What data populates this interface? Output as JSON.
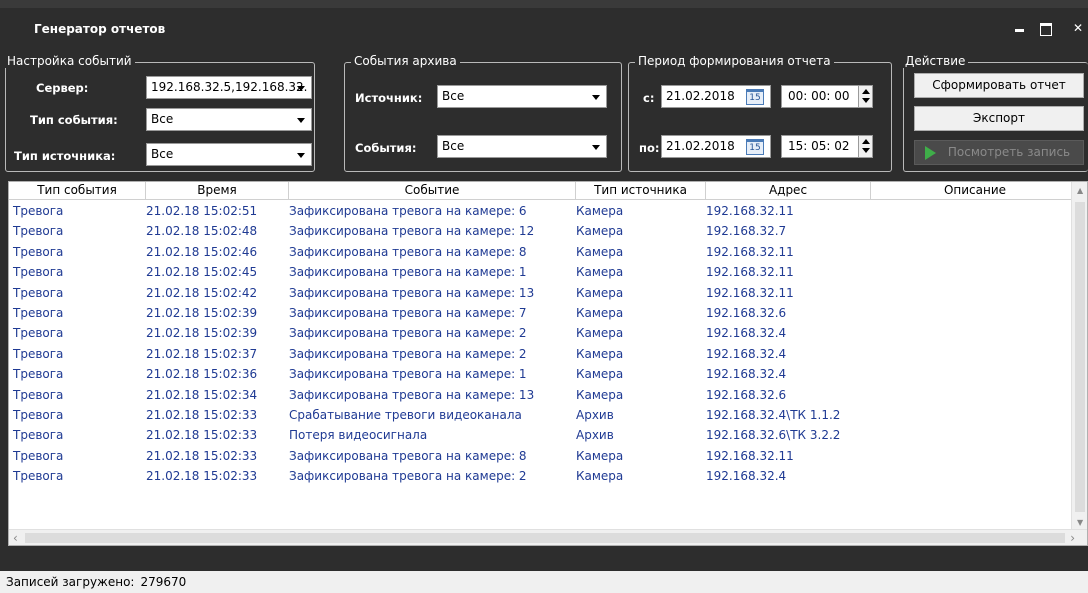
{
  "window": {
    "title": "Генератор отчетов"
  },
  "events_setup": {
    "title": "Настройка событий",
    "server_label": "Сервер:",
    "server_value": "192.168.32.5,192.168.32.",
    "event_type_label": "Тип события:",
    "event_type_value": "Все",
    "source_type_label": "Тип источника:",
    "source_type_value": "Все"
  },
  "archive_events": {
    "title": "События архива",
    "source_label": "Источник:",
    "source_value": "Все",
    "events_label": "События:",
    "events_value": "Все"
  },
  "period": {
    "title": "Период формирования отчета",
    "from_label": "с:",
    "from_date": "21.02.2018",
    "from_time": "00: 00: 00",
    "to_label": "по:",
    "to_date": "21.02.2018",
    "to_time": "15: 05: 02",
    "calendar_day": "15"
  },
  "actions": {
    "title": "Действие",
    "generate_label": "Сформировать отчет",
    "export_label": "Экспорт",
    "view_record_label": "Посмотреть запись"
  },
  "table": {
    "columns": [
      "Тип события",
      "Время",
      "Событие",
      "Тип источника",
      "Адрес",
      "Описание"
    ],
    "rows": [
      [
        "Тревога",
        "21.02.18 15:02:51",
        "Зафиксирована тревога на камере: 6",
        "Камера",
        "192.168.32.11",
        ""
      ],
      [
        "Тревога",
        "21.02.18 15:02:48",
        "Зафиксирована тревога на камере: 12",
        "Камера",
        "192.168.32.7",
        ""
      ],
      [
        "Тревога",
        "21.02.18 15:02:46",
        "Зафиксирована тревога на камере: 8",
        "Камера",
        "192.168.32.11",
        ""
      ],
      [
        "Тревога",
        "21.02.18 15:02:45",
        "Зафиксирована тревога на камере: 1",
        "Камера",
        "192.168.32.11",
        ""
      ],
      [
        "Тревога",
        "21.02.18 15:02:42",
        "Зафиксирована тревога на камере: 13",
        "Камера",
        "192.168.32.11",
        ""
      ],
      [
        "Тревога",
        "21.02.18 15:02:39",
        "Зафиксирована тревога на камере: 7",
        "Камера",
        "192.168.32.6",
        ""
      ],
      [
        "Тревога",
        "21.02.18 15:02:39",
        "Зафиксирована тревога на камере: 2",
        "Камера",
        "192.168.32.4",
        ""
      ],
      [
        "Тревога",
        "21.02.18 15:02:37",
        "Зафиксирована тревога на камере: 2",
        "Камера",
        "192.168.32.4",
        ""
      ],
      [
        "Тревога",
        "21.02.18 15:02:36",
        "Зафиксирована тревога на камере: 1",
        "Камера",
        "192.168.32.4",
        ""
      ],
      [
        "Тревога",
        "21.02.18 15:02:34",
        "Зафиксирована тревога на камере: 13",
        "Камера",
        "192.168.32.6",
        ""
      ],
      [
        "Тревога",
        "21.02.18 15:02:33",
        "Срабатывание тревоги видеоканала",
        "Архив",
        "192.168.32.4\\ТК 1.1.2",
        ""
      ],
      [
        "Тревога",
        "21.02.18 15:02:33",
        "Потеря видеосигнала",
        "Архив",
        "192.168.32.6\\ТК 3.2.2",
        ""
      ],
      [
        "Тревога",
        "21.02.18 15:02:33",
        "Зафиксирована тревога на камере: 8",
        "Камера",
        "192.168.32.11",
        ""
      ],
      [
        "Тревога",
        "21.02.18 15:02:33",
        "Зафиксирована тревога на камере: 2",
        "Камера",
        "192.168.32.4",
        ""
      ]
    ]
  },
  "status": {
    "label": "Записей загружено:",
    "value": "279670"
  },
  "colors": {
    "row_text": "#1f3a93",
    "window_bg": "#2d2d2d",
    "play_icon": "#3fae49"
  }
}
